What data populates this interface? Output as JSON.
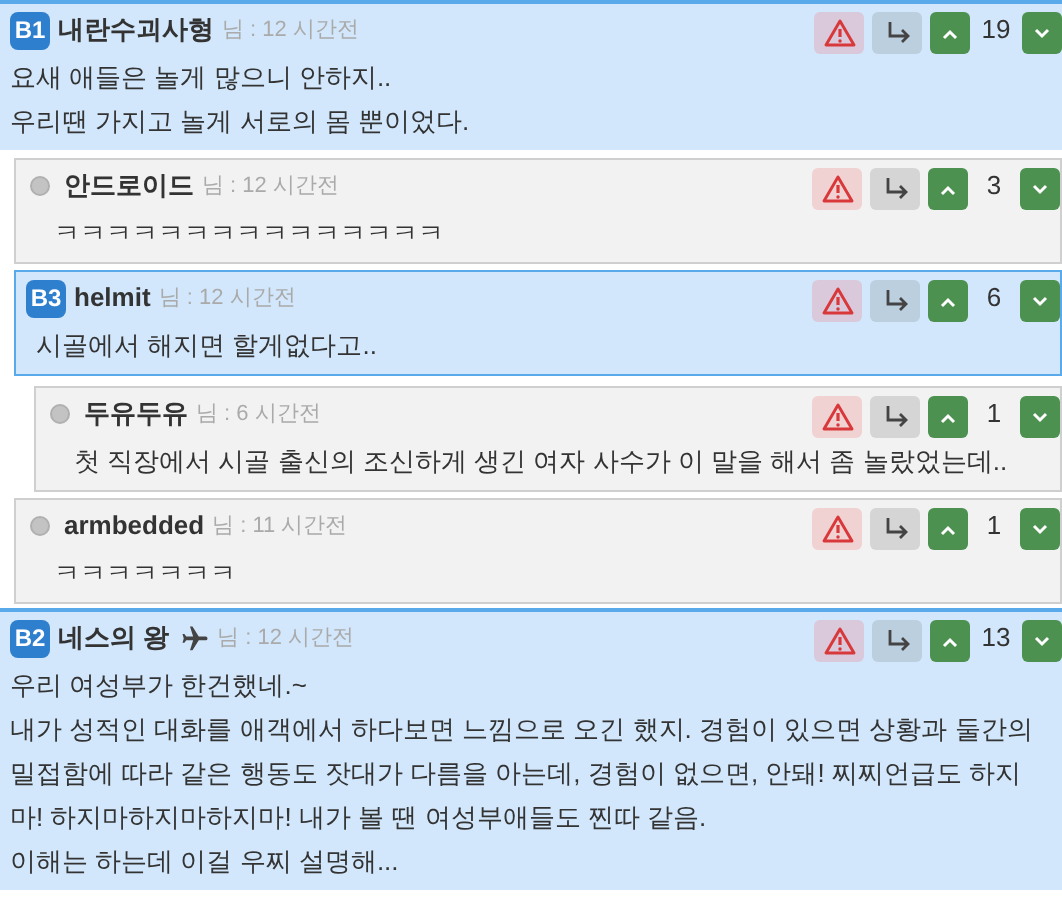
{
  "comments": [
    {
      "kind": "best",
      "badge": "B1",
      "name": "내란수괴사형",
      "has_plane_icon": false,
      "meta": "님 : 12 시간전",
      "votes": "19",
      "lines": [
        "요새 애들은 놀게 많으니 안하지..",
        "우리땐 가지고 놀게 서로의 몸 뿐이었다."
      ],
      "children": [
        {
          "kind": "normal",
          "name": "안드로이드",
          "has_plane_icon": false,
          "meta": "님 : 12 시간전",
          "votes": "3",
          "lines": [
            "ㅋㅋㅋㅋㅋㅋㅋㅋㅋㅋㅋㅋㅋㅋㅋ"
          ]
        },
        {
          "kind": "best",
          "badge": "B3",
          "name": "helmit",
          "has_plane_icon": false,
          "meta": "님 : 12 시간전",
          "votes": "6",
          "lines": [
            "시골에서 해지면 할게없다고.."
          ],
          "children": [
            {
              "kind": "normal",
              "name": "두유두유",
              "has_plane_icon": false,
              "meta": "님 : 6 시간전",
              "votes": "1",
              "lines": [
                "첫 직장에서 시골 출신의 조신하게 생긴 여자 사수가 이 말을 해서 좀 놀랐었는데.."
              ]
            }
          ]
        },
        {
          "kind": "normal",
          "name": "armbedded",
          "has_plane_icon": false,
          "meta": "님 : 11 시간전",
          "votes": "1",
          "lines": [
            "ㅋㅋㅋㅋㅋㅋㅋ"
          ]
        }
      ]
    },
    {
      "kind": "best",
      "badge": "B2",
      "name": "네스의 왕",
      "has_plane_icon": true,
      "meta": "님 : 12 시간전",
      "votes": "13",
      "lines": [
        "우리 여성부가 한건했네.~",
        "내가 성적인 대화를 애객에서 하다보면 느낌으로 오긴 했지. 경험이 있으면 상황과 둘간의 밀접함에 따라 같은 행동도 잣대가 다름을 아는데, 경험이 없으면, 안돼! 찌찌언급도 하지마! 하지마하지마하지마! 내가 볼 땐 여성부애들도 찐따 같음.",
        "이해는 하는데 이걸 우찌 설명해..."
      ]
    }
  ]
}
